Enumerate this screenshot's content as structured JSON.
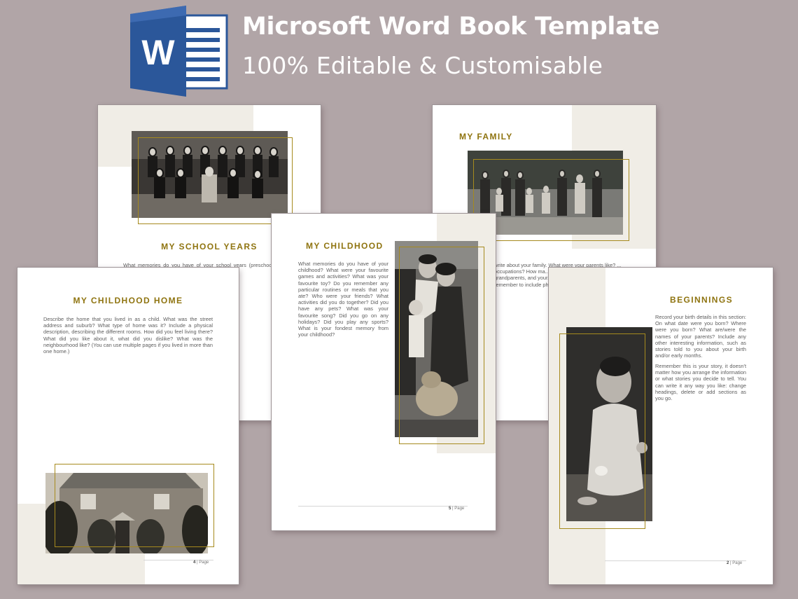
{
  "header": {
    "title": "Microsoft Word Book Template",
    "subtitle": "100% Editable & Customisable",
    "logo_icon": "microsoft-word-logo-icon",
    "logo_letter": "W"
  },
  "colors": {
    "background": "#b1a5a7",
    "gold": "#8f7410",
    "beige": "#f0ede6",
    "word_blue": "#2b579a"
  },
  "pages": {
    "school_years": {
      "title": "MY SCHOOL YEARS",
      "text": "What memories do you have of your school years (preschool, pri... you recall an... What was your ...ol? What did y..."
    },
    "family": {
      "title": "MY FAMILY",
      "text": "write about your family. What were your parents like? ... occupations? How ma... the names of your siblin... grandparents, and your... cousins? Did you visit t... remember to include ph... other interesting memo..."
    },
    "childhood_home": {
      "title": "MY CHILDHOOD HOME",
      "text": "Describe the home that you lived in as a child. What was the street address and suburb? What type of home was it? Include a physical description, describing the different rooms. How did you feel living there? What did you like about it, what did you dislike? What was the neighbourhood like? (You can use multiple pages if you lived in more than one home.)",
      "page_number": "4",
      "page_label": "Page"
    },
    "childhood": {
      "title": "MY CHILDHOOD",
      "text": "What memories do you have of your childhood? What were your favourite games and activities? What was your favourite toy? Do you remember any particular routines or meals that you ate? Who were your friends? What activities did you do together? Did you have any pets? What was your favourite song? Did you go on any holidays? Did you play any sports? What is your fondest memory from your childhood?",
      "page_number": "5",
      "page_label": "Page"
    },
    "beginnings": {
      "title": "BEGINNINGS",
      "text1": "Record your birth details in this section: On what date were you born? Where were you born? What are/were the names of your parents? Include any other interesting information, such as stories told to you about your birth and/or early months.",
      "text2": "Remember this is your story, it doesn't matter how you arrange the information or what stories you decide to tell. You can write it any way you like: change headings, delete or add sections as you go.",
      "page_number": "2",
      "page_label": "Page"
    }
  }
}
